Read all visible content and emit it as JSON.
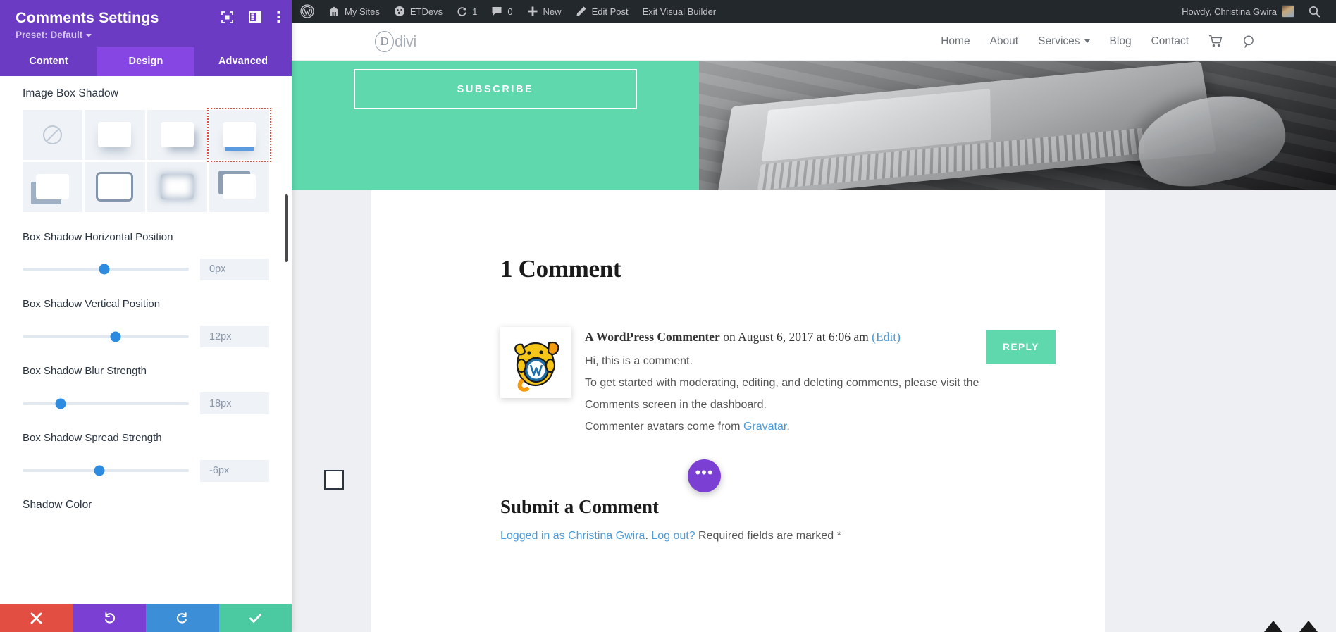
{
  "panel": {
    "title": "Comments Settings",
    "preset_label": "Preset: Default",
    "header_icons": [
      {
        "name": "focus-icon"
      },
      {
        "name": "layout-panel-icon"
      },
      {
        "name": "more-vertical-icon"
      }
    ],
    "tabs": [
      {
        "label": "Content",
        "active": false
      },
      {
        "label": "Design",
        "active": true
      },
      {
        "label": "Advanced",
        "active": false
      }
    ],
    "section_title": "Image Box Shadow",
    "shadow_presets": [
      {
        "name": "none",
        "selected": false
      },
      {
        "name": "soft-glow",
        "selected": false
      },
      {
        "name": "bottom-right-drop",
        "selected": false
      },
      {
        "name": "blue-underline",
        "selected": true
      },
      {
        "name": "left-offset-solid",
        "selected": false
      },
      {
        "name": "outline-ring",
        "selected": false
      },
      {
        "name": "inner-glow",
        "selected": false
      },
      {
        "name": "top-left-solid",
        "selected": false
      }
    ],
    "sliders": [
      {
        "label": "Box Shadow Horizontal Position",
        "value": "0px",
        "pct": 49
      },
      {
        "label": "Box Shadow Vertical Position",
        "value": "12px",
        "pct": 56
      },
      {
        "label": "Box Shadow Blur Strength",
        "value": "18px",
        "pct": 23
      },
      {
        "label": "Box Shadow Spread Strength",
        "value": "-6px",
        "pct": 46
      }
    ],
    "color_label": "Shadow Color",
    "footer": [
      {
        "name": "discard-button",
        "glyph": "✖",
        "color": "#E24F42"
      },
      {
        "name": "undo-button",
        "glyph": "↺",
        "color": "#7B3FD4"
      },
      {
        "name": "redo-button",
        "glyph": "↻",
        "color": "#3C8ED6"
      },
      {
        "name": "save-button",
        "glyph": "✔",
        "color": "#4BC9A0"
      }
    ]
  },
  "adminbar": {
    "items": [
      {
        "name": "wordpress-logo-icon",
        "label": ""
      },
      {
        "name": "my-sites",
        "label": "My Sites"
      },
      {
        "name": "site-name",
        "label": "ETDevs"
      },
      {
        "name": "updates",
        "label": "1"
      },
      {
        "name": "comments",
        "label": "0"
      },
      {
        "name": "new",
        "label": "New"
      },
      {
        "name": "edit-post",
        "label": "Edit Post"
      },
      {
        "name": "exit-visual-builder",
        "label": "Exit Visual Builder"
      }
    ],
    "howdy": "Howdy, Christina Gwira"
  },
  "sitenav": {
    "logo_letter": "D",
    "logo_text": "divi",
    "links": [
      {
        "label": "Home",
        "dropdown": false
      },
      {
        "label": "About",
        "dropdown": false
      },
      {
        "label": "Services",
        "dropdown": true
      },
      {
        "label": "Blog",
        "dropdown": false
      },
      {
        "label": "Contact",
        "dropdown": false
      }
    ],
    "cart_icon": "cart-icon",
    "search_icon": "search-icon"
  },
  "hero": {
    "subscribe_label": "SUBSCRIBE",
    "bg_color": "#5FD8AE"
  },
  "comments": {
    "heading": "1 Comment",
    "author": "A WordPress Commenter",
    "meta_mid": " on August 6, 2017 at 6:06 am ",
    "edit_label": "(Edit)",
    "reply_label": "REPLY",
    "body": [
      "Hi, this is a comment.",
      "To get started with moderating, editing, and deleting comments, please visit the",
      "Comments screen in the dashboard."
    ],
    "gravatar_prefix": "Commenter avatars come from ",
    "gravatar_link": "Gravatar",
    "gravatar_suffix": ".",
    "submit_heading": "Submit a Comment",
    "logged_in_prefix": "Logged in as Christina Gwira",
    "logged_in_sep": ". ",
    "logout_label": "Log out?",
    "required_note": " Required fields are marked *"
  },
  "fab": {
    "glyph": "•••",
    "color": "#7B3FD4"
  }
}
